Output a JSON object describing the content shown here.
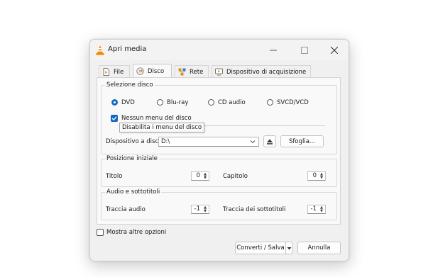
{
  "window": {
    "title": "Apri media"
  },
  "window_controls": {
    "minimize": "—",
    "maximize": "☐",
    "close": "✕"
  },
  "tabs": [
    {
      "label": "File",
      "active": false
    },
    {
      "label": "Disco",
      "active": true
    },
    {
      "label": "Rete",
      "active": false
    },
    {
      "label": "Dispositivo di acquisizione",
      "active": false
    }
  ],
  "disc_selection": {
    "title": "Selezione disco",
    "options": [
      "DVD",
      "Blu-ray",
      "CD audio",
      "SVCD/VCD"
    ],
    "selected": "DVD",
    "no_menus_label": "Nessun menu del disco",
    "no_menus_checked": true,
    "tooltip": "Disabilita i menu del disco",
    "device_label": "Dispositivo a disco",
    "device_value": "D:\\",
    "browse_label": "Sfoglia..."
  },
  "starting_position": {
    "title": "Posizione iniziale",
    "title_label": "Titolo",
    "title_value": "0",
    "chapter_label": "Capitolo",
    "chapter_value": "0"
  },
  "audio_subtitles": {
    "title": "Audio e sottotitoli",
    "audio_track_label": "Traccia audio",
    "audio_track_value": "-1",
    "subtitle_track_label": "Traccia dei sottotitoli",
    "subtitle_track_value": "-1"
  },
  "footer": {
    "more_options_label": "Mostra altre opzioni",
    "more_options_checked": false,
    "convert_label": "Converti / Salva",
    "cancel_label": "Annulla"
  },
  "colors": {
    "accent": "#1368c4",
    "vlc_orange": "#f08a00"
  }
}
